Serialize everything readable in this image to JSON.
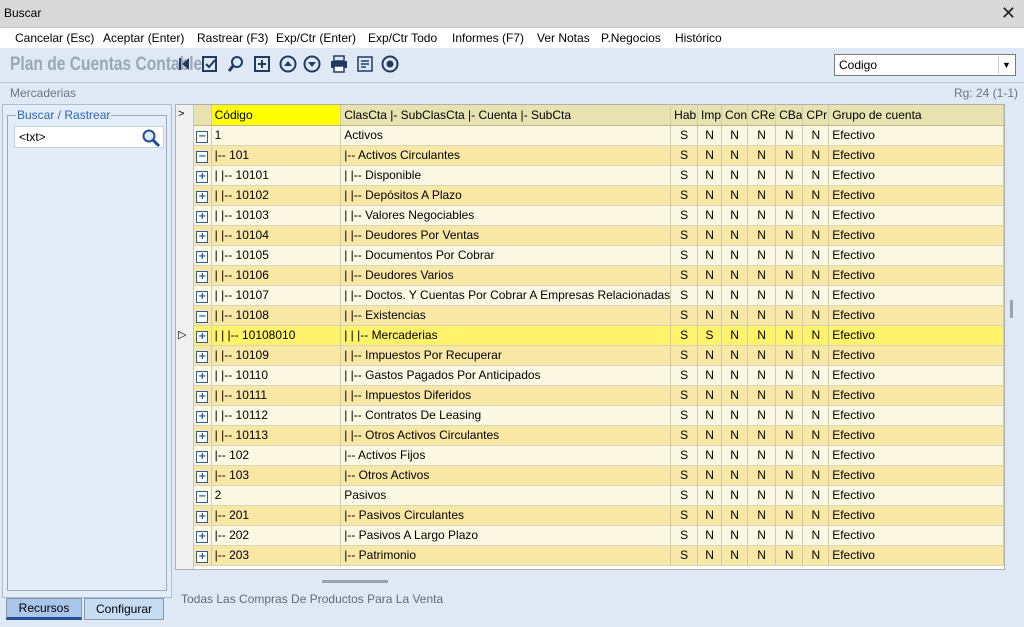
{
  "window": {
    "title": "Buscar",
    "close": "✕"
  },
  "menu": [
    "Cancelar (Esc)",
    "Aceptar (Enter)",
    "Rastrear (F3)",
    "Exp/Ctr (Enter)",
    "Exp/Ctr Todo",
    "Informes (F7)",
    "Ver Notas",
    "P.Negocios",
    "Histórico"
  ],
  "toolbar": {
    "app_title": "Plan de Cuentas Contable",
    "icons": [
      "back-arrow-icon",
      "edit-check-icon",
      "search-icon",
      "expand-box-icon",
      "arrow-up-icon",
      "arrow-down-icon",
      "print-icon",
      "notes-icon",
      "target-icon"
    ],
    "select_value": "Codigo"
  },
  "breadcrumb": "Mercaderias",
  "record_count": "Rg: 24 (1-1)",
  "search": {
    "legend": "Buscar / Rastrear",
    "value": "<txt>"
  },
  "tabs": {
    "recursos": "Recursos",
    "configurar": "Configurar"
  },
  "grid": {
    "corner": ">",
    "columns": [
      "Código",
      "ClasCta  |- SubClasCta  |- Cuenta  |- SubCta",
      "Hab",
      "Imp",
      "Con",
      "CRe",
      "CBa",
      "CPr",
      "Grupo de cuenta"
    ],
    "rows": [
      {
        "pm": "−",
        "codigo": "1",
        "desc": "Activos",
        "hab": "S",
        "imp": "N",
        "con": "N",
        "cre": "N",
        "cba": "N",
        "cpr": "N",
        "grupo": "Efectivo"
      },
      {
        "pm": "−",
        "codigo": "|-- 101",
        "desc": "|-- Activos Circulantes",
        "hab": "S",
        "imp": "N",
        "con": "N",
        "cre": "N",
        "cba": "N",
        "cpr": "N",
        "grupo": "Efectivo"
      },
      {
        "pm": "+",
        "codigo": "|    |-- 10101",
        "desc": "|    |-- Disponible",
        "hab": "S",
        "imp": "N",
        "con": "N",
        "cre": "N",
        "cba": "N",
        "cpr": "N",
        "grupo": "Efectivo"
      },
      {
        "pm": "+",
        "codigo": "|    |-- 10102",
        "desc": "|    |-- Depósitos A Plazo",
        "hab": "S",
        "imp": "N",
        "con": "N",
        "cre": "N",
        "cba": "N",
        "cpr": "N",
        "grupo": "Efectivo"
      },
      {
        "pm": "+",
        "codigo": "|    |-- 10103",
        "desc": "|    |-- Valores Negociables",
        "hab": "S",
        "imp": "N",
        "con": "N",
        "cre": "N",
        "cba": "N",
        "cpr": "N",
        "grupo": "Efectivo"
      },
      {
        "pm": "+",
        "codigo": "|    |-- 10104",
        "desc": "|    |-- Deudores Por Ventas",
        "hab": "S",
        "imp": "N",
        "con": "N",
        "cre": "N",
        "cba": "N",
        "cpr": "N",
        "grupo": "Efectivo"
      },
      {
        "pm": "+",
        "codigo": "|    |-- 10105",
        "desc": "|    |-- Documentos Por Cobrar",
        "hab": "S",
        "imp": "N",
        "con": "N",
        "cre": "N",
        "cba": "N",
        "cpr": "N",
        "grupo": "Efectivo"
      },
      {
        "pm": "+",
        "codigo": "|    |-- 10106",
        "desc": "|    |-- Deudores Varios",
        "hab": "S",
        "imp": "N",
        "con": "N",
        "cre": "N",
        "cba": "N",
        "cpr": "N",
        "grupo": "Efectivo"
      },
      {
        "pm": "+",
        "codigo": "|    |-- 10107",
        "desc": "|    |-- Doctos. Y Cuentas Por Cobrar A Empresas Relacionadas",
        "hab": "S",
        "imp": "N",
        "con": "N",
        "cre": "N",
        "cba": "N",
        "cpr": "N",
        "grupo": "Efectivo"
      },
      {
        "pm": "−",
        "codigo": "|    |-- 10108",
        "desc": "|    |-- Existencias",
        "hab": "S",
        "imp": "N",
        "con": "N",
        "cre": "N",
        "cba": "N",
        "cpr": "N",
        "grupo": "Efectivo"
      },
      {
        "pm": "+",
        "codigo": "|    |    |-- 10108010",
        "desc": "|    |    |-- Mercaderias",
        "hab": "S",
        "imp": "S",
        "con": "N",
        "cre": "N",
        "cba": "N",
        "cpr": "N",
        "grupo": "Efectivo",
        "selected": true
      },
      {
        "pm": "+",
        "codigo": "|    |-- 10109",
        "desc": "|    |-- Impuestos Por Recuperar",
        "hab": "S",
        "imp": "N",
        "con": "N",
        "cre": "N",
        "cba": "N",
        "cpr": "N",
        "grupo": "Efectivo"
      },
      {
        "pm": "+",
        "codigo": "|    |-- 10110",
        "desc": "|    |-- Gastos Pagados Por Anticipados",
        "hab": "S",
        "imp": "N",
        "con": "N",
        "cre": "N",
        "cba": "N",
        "cpr": "N",
        "grupo": "Efectivo"
      },
      {
        "pm": "+",
        "codigo": "|    |-- 10111",
        "desc": "|    |-- Impuestos Diferidos",
        "hab": "S",
        "imp": "N",
        "con": "N",
        "cre": "N",
        "cba": "N",
        "cpr": "N",
        "grupo": "Efectivo"
      },
      {
        "pm": "+",
        "codigo": "|    |-- 10112",
        "desc": "|    |-- Contratos De Leasing",
        "hab": "S",
        "imp": "N",
        "con": "N",
        "cre": "N",
        "cba": "N",
        "cpr": "N",
        "grupo": "Efectivo"
      },
      {
        "pm": "+",
        "codigo": "|    |-- 10113",
        "desc": "|    |-- Otros Activos Circulantes",
        "hab": "S",
        "imp": "N",
        "con": "N",
        "cre": "N",
        "cba": "N",
        "cpr": "N",
        "grupo": "Efectivo"
      },
      {
        "pm": "+",
        "codigo": "|-- 102",
        "desc": "|-- Activos Fijos",
        "hab": "S",
        "imp": "N",
        "con": "N",
        "cre": "N",
        "cba": "N",
        "cpr": "N",
        "grupo": "Efectivo"
      },
      {
        "pm": "+",
        "codigo": "|-- 103",
        "desc": "|-- Otros Activos",
        "hab": "S",
        "imp": "N",
        "con": "N",
        "cre": "N",
        "cba": "N",
        "cpr": "N",
        "grupo": "Efectivo"
      },
      {
        "pm": "−",
        "codigo": "2",
        "desc": "Pasivos",
        "hab": "S",
        "imp": "N",
        "con": "N",
        "cre": "N",
        "cba": "N",
        "cpr": "N",
        "grupo": "Efectivo"
      },
      {
        "pm": "+",
        "codigo": "|-- 201",
        "desc": "|-- Pasivos Circulantes",
        "hab": "S",
        "imp": "N",
        "con": "N",
        "cre": "N",
        "cba": "N",
        "cpr": "N",
        "grupo": "Efectivo"
      },
      {
        "pm": "+",
        "codigo": "|-- 202",
        "desc": "|-- Pasivos A Largo Plazo",
        "hab": "S",
        "imp": "N",
        "con": "N",
        "cre": "N",
        "cba": "N",
        "cpr": "N",
        "grupo": "Efectivo"
      },
      {
        "pm": "+",
        "codigo": "|-- 203",
        "desc": "|-- Patrimonio",
        "hab": "S",
        "imp": "N",
        "con": "N",
        "cre": "N",
        "cba": "N",
        "cpr": "N",
        "grupo": "Efectivo"
      }
    ]
  },
  "footer": "Todas Las Compras De Productos Para La Venta"
}
